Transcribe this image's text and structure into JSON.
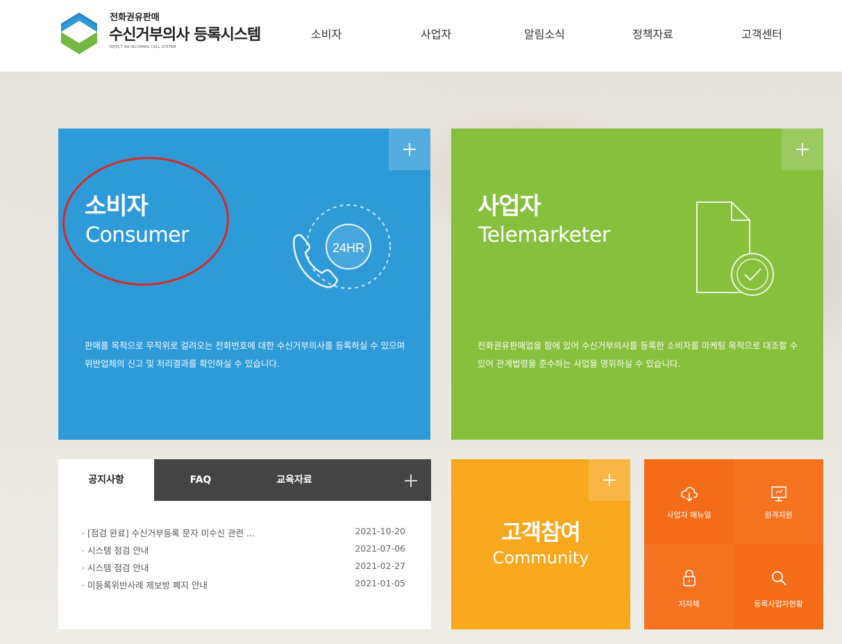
{
  "header": {
    "logo_sub": "전화권유판매",
    "logo_title": "수신거부의사 등록시스템",
    "logo_eng": "REJECT AN INCOMING CALL SYSTEM",
    "nav": [
      "소비자",
      "사업자",
      "알림소식",
      "정책자료",
      "고객센터"
    ]
  },
  "consumer_card": {
    "title": "소비자",
    "subtitle": "Consumer",
    "icon_label": "24HR",
    "description": "판매를 목적으로 무작위로 걸려오는 전화번호에 대한 수신거부의사를 등록하실 수 있으며 위반업체의 신고 및 처리결과를 확인하실 수 있습니다.",
    "color": "#2e9bd8"
  },
  "telemarketer_card": {
    "title": "사업자",
    "subtitle": "Telemarketer",
    "description": "전화권유판매업을 함에 있어 수신거부의사를 등록한 소비자를 마케팅 목적으로 대조할 수 있어 관계법령을 준수하는 사업을 영위하실 수 있습니다.",
    "color": "#86c03d"
  },
  "notice": {
    "tabs": [
      "공지사항",
      "FAQ",
      "교육자료"
    ],
    "items": [
      {
        "title": "· [점검 완료] 수신거부등록 문자 미수신 관련 ...",
        "date": "2021-10-20"
      },
      {
        "title": "· 시스템 점검 안내",
        "date": "2021-07-06"
      },
      {
        "title": "· 시스템 점검 안내",
        "date": "2021-02-27"
      },
      {
        "title": "· 미등록위반사례 제보방 폐지 안내",
        "date": "2021-01-05"
      }
    ]
  },
  "community_card": {
    "title": "고객참여",
    "subtitle": "Community",
    "color": "#f7a81c"
  },
  "quick_links": {
    "items": [
      {
        "label": "사업자 매뉴얼",
        "icon": "cloud-download-icon"
      },
      {
        "label": "원격지원",
        "icon": "monitor-icon"
      },
      {
        "label": "지자체",
        "icon": "lock-icon"
      },
      {
        "label": "등록사업자현황",
        "icon": "search-icon"
      }
    ],
    "color": "#f46c16"
  },
  "annotation": {
    "color": "#d92a22"
  }
}
